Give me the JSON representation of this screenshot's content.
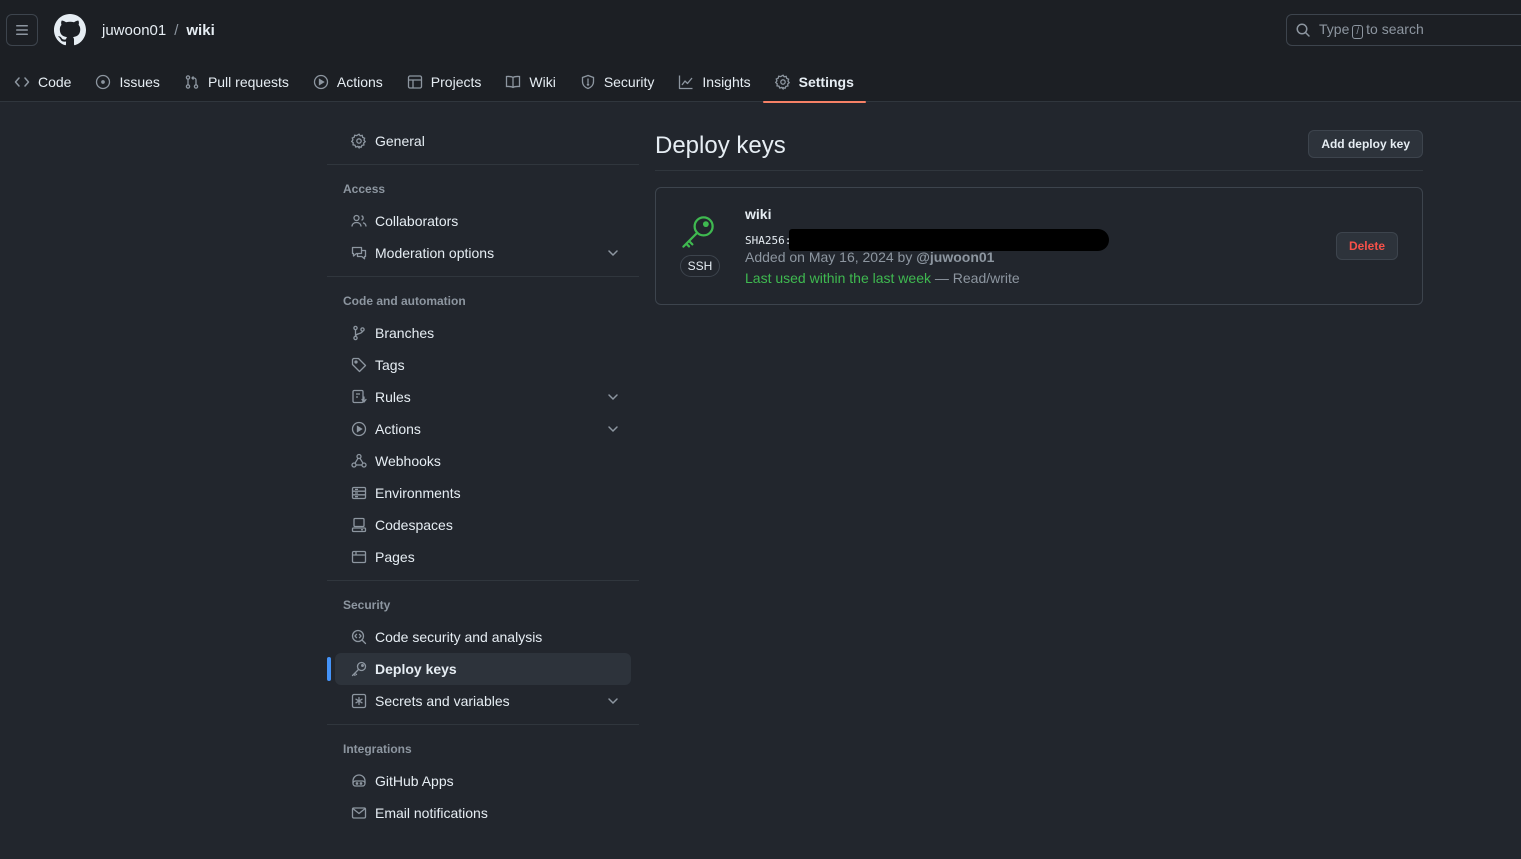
{
  "header": {
    "owner": "juwoon01",
    "separator": "/",
    "repo": "wiki",
    "search": {
      "prefix": "Type",
      "key": "/",
      "suffix": "to search"
    }
  },
  "repo_nav": [
    {
      "label": "Code",
      "icon": "code-icon"
    },
    {
      "label": "Issues",
      "icon": "issue-icon"
    },
    {
      "label": "Pull requests",
      "icon": "pull-request-icon"
    },
    {
      "label": "Actions",
      "icon": "play-icon"
    },
    {
      "label": "Projects",
      "icon": "table-icon"
    },
    {
      "label": "Wiki",
      "icon": "book-icon"
    },
    {
      "label": "Security",
      "icon": "shield-icon"
    },
    {
      "label": "Insights",
      "icon": "graph-icon"
    },
    {
      "label": "Settings",
      "icon": "gear-icon",
      "active": true
    }
  ],
  "sidebar": {
    "general": "General",
    "sections": [
      {
        "heading": "Access",
        "items": [
          {
            "label": "Collaborators",
            "icon": "people-icon"
          },
          {
            "label": "Moderation options",
            "icon": "comment-icon",
            "expandable": true
          }
        ]
      },
      {
        "heading": "Code and automation",
        "items": [
          {
            "label": "Branches",
            "icon": "branch-icon"
          },
          {
            "label": "Tags",
            "icon": "tag-icon"
          },
          {
            "label": "Rules",
            "icon": "rules-icon",
            "expandable": true
          },
          {
            "label": "Actions",
            "icon": "play-icon",
            "expandable": true
          },
          {
            "label": "Webhooks",
            "icon": "webhook-icon"
          },
          {
            "label": "Environments",
            "icon": "server-icon"
          },
          {
            "label": "Codespaces",
            "icon": "codespaces-icon"
          },
          {
            "label": "Pages",
            "icon": "browser-icon"
          }
        ]
      },
      {
        "heading": "Security",
        "items": [
          {
            "label": "Code security and analysis",
            "icon": "codescan-icon"
          },
          {
            "label": "Deploy keys",
            "icon": "key-icon",
            "selected": true
          },
          {
            "label": "Secrets and variables",
            "icon": "asterisk-icon",
            "expandable": true
          }
        ]
      },
      {
        "heading": "Integrations",
        "items": [
          {
            "label": "GitHub Apps",
            "icon": "apps-icon"
          },
          {
            "label": "Email notifications",
            "icon": "mail-icon"
          }
        ]
      }
    ]
  },
  "main": {
    "title": "Deploy keys",
    "add_button": "Add deploy key",
    "key": {
      "badge": "SSH",
      "title": "wiki",
      "fingerprint_prefix": "SHA256:",
      "added_prefix": "Added on May 16, 2024 by",
      "added_by": "@juwoon01",
      "last_used": "Last used within the last week",
      "access": "— Read/write",
      "delete_button": "Delete"
    }
  },
  "colors": {
    "accent_underline": "#f78166",
    "selected_bar": "#4493f8",
    "success": "#3fb950",
    "danger": "#f85149"
  }
}
